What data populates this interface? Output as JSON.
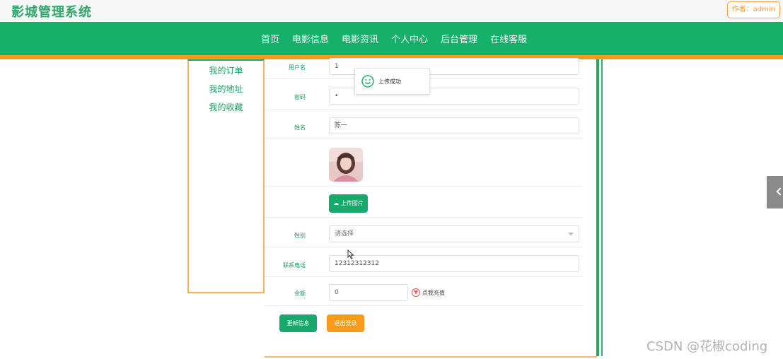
{
  "header": {
    "site_title": "影城管理系统",
    "author_badge": "作者：admin"
  },
  "nav": {
    "items": [
      "首页",
      "电影信息",
      "电影资讯",
      "个人中心",
      "后台管理",
      "在线客服"
    ]
  },
  "sidebar": {
    "items": [
      "我的订单",
      "我的地址",
      "我的收藏"
    ]
  },
  "form": {
    "username": {
      "label": "用户名",
      "value": "1"
    },
    "password": {
      "label": "密码",
      "value": "•"
    },
    "name": {
      "label": "姓名",
      "value": "陈一"
    },
    "upload_button": "上传图片",
    "gender": {
      "label": "性别",
      "placeholder": "请选择"
    },
    "phone": {
      "label": "联系电话",
      "value": "12312312312"
    },
    "balance": {
      "label": "余额",
      "value": "0",
      "recharge_link": "点我充值"
    },
    "update_button": "更新信息",
    "logout_button": "退出登录"
  },
  "toast": {
    "message": "上传成功"
  },
  "watermark": "CSDN @花椒coding",
  "colors": {
    "brand_green": "#15b06a",
    "accent_orange": "#f59a1c"
  }
}
